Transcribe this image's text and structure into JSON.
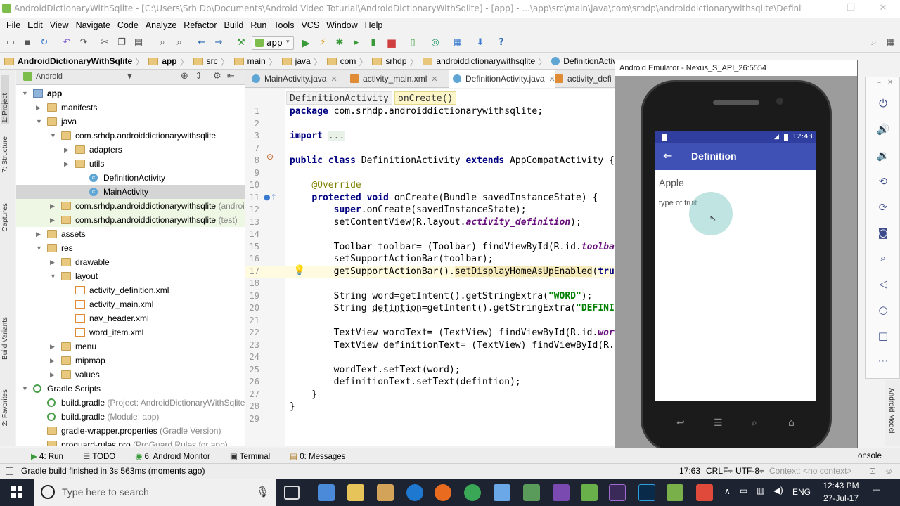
{
  "window": {
    "title": "AndroidDictionaryWithSqlite - [C:\\Users\\Srh Dp\\Documents\\Android Video Toturial\\AndroidDictionaryWithSqlite] - [app] - ...\\app\\src\\main\\java\\com\\srhdp\\androiddictionarywithsqlite\\DefinitionActivity.java - A..."
  },
  "menu": [
    "File",
    "Edit",
    "View",
    "Navigate",
    "Code",
    "Analyze",
    "Refactor",
    "Build",
    "Run",
    "Tools",
    "VCS",
    "Window",
    "Help"
  ],
  "toolbar": {
    "run_config": "app"
  },
  "breadcrumbs": [
    "AndroidDictionaryWithSqlite",
    "app",
    "src",
    "main",
    "java",
    "com",
    "srhdp",
    "androiddictionarywithsqlite",
    "DefinitionActivity"
  ],
  "left_tabs": [
    "1: Project",
    "7: Structure",
    "Captures",
    "Build Variants",
    "2: Favorites"
  ],
  "project": {
    "view_mode": "Android",
    "tree": [
      {
        "label": "app",
        "level": 0,
        "arrow": "down",
        "icon": "foldb",
        "bold": true
      },
      {
        "label": "manifests",
        "level": 1,
        "arrow": "right",
        "icon": "fold"
      },
      {
        "label": "java",
        "level": 1,
        "arrow": "down",
        "icon": "fold"
      },
      {
        "label": "com.srhdp.androiddictionarywithsqlite",
        "level": 2,
        "arrow": "down",
        "icon": "fold"
      },
      {
        "label": "adapters",
        "level": 3,
        "arrow": "right",
        "icon": "fold"
      },
      {
        "label": "utils",
        "level": 3,
        "arrow": "right",
        "icon": "fold"
      },
      {
        "label": "DefinitionActivity",
        "level": 4,
        "arrow": "",
        "icon": "cls"
      },
      {
        "label": "MainActivity",
        "level": 4,
        "arrow": "",
        "icon": "cls",
        "selected": true
      },
      {
        "label": "com.srhdp.androiddictionarywithsqlite",
        "suffix": " (androi",
        "level": 2,
        "arrow": "right",
        "icon": "fold",
        "tinted": true
      },
      {
        "label": "com.srhdp.androiddictionarywithsqlite",
        "suffix": " (test)",
        "level": 2,
        "arrow": "right",
        "icon": "fold",
        "tinted": true
      },
      {
        "label": "assets",
        "level": 1,
        "arrow": "right",
        "icon": "fold"
      },
      {
        "label": "res",
        "level": 1,
        "arrow": "down",
        "icon": "fold"
      },
      {
        "label": "drawable",
        "level": 2,
        "arrow": "right",
        "icon": "fold"
      },
      {
        "label": "layout",
        "level": 2,
        "arrow": "down",
        "icon": "fold"
      },
      {
        "label": "activity_definition.xml",
        "level": 3,
        "arrow": "",
        "icon": "xml"
      },
      {
        "label": "activity_main.xml",
        "level": 3,
        "arrow": "",
        "icon": "xml"
      },
      {
        "label": "nav_header.xml",
        "level": 3,
        "arrow": "",
        "icon": "xml"
      },
      {
        "label": "word_item.xml",
        "level": 3,
        "arrow": "",
        "icon": "xml"
      },
      {
        "label": "menu",
        "level": 2,
        "arrow": "right",
        "icon": "fold"
      },
      {
        "label": "mipmap",
        "level": 2,
        "arrow": "right",
        "icon": "fold"
      },
      {
        "label": "values",
        "level": 2,
        "arrow": "right",
        "icon": "fold"
      },
      {
        "label": "Gradle Scripts",
        "level": 0,
        "arrow": "down",
        "icon": "grad"
      },
      {
        "label": "build.gradle",
        "suffix": " (Project: AndroidDictionaryWithSqlite",
        "level": 1,
        "arrow": "",
        "icon": "grad"
      },
      {
        "label": "build.gradle",
        "suffix": " (Module: app)",
        "level": 1,
        "arrow": "",
        "icon": "grad"
      },
      {
        "label": "gradle-wrapper.properties",
        "suffix": " (Gradle Version)",
        "level": 1,
        "arrow": "",
        "icon": "fold"
      },
      {
        "label": "proguard-rules.pro",
        "suffix": " (ProGuard Rules for app)",
        "level": 1,
        "arrow": "",
        "icon": "fold"
      }
    ]
  },
  "editor_tabs": [
    {
      "label": "MainActivity.java",
      "color": "#5fa6d4"
    },
    {
      "label": "activity_main.xml",
      "color": "#e08b35"
    },
    {
      "label": "DefinitionActivity.java",
      "color": "#5fa6d4",
      "active": true
    },
    {
      "label": "activity_defi",
      "color": "#e08b35"
    }
  ],
  "method_bar": {
    "class": "DefinitionActivity",
    "method": "onCreate()"
  },
  "code": [
    {
      "n": "1",
      "html": "<span class=\"kw\">package</span> com.srhdp.androiddictionarywithsqlite;"
    },
    {
      "n": "2",
      "html": ""
    },
    {
      "n": "3",
      "html": "<span class=\"kw\">import</span> <span style=\"background:#e8f2e8;color:#666\">...</span>"
    },
    {
      "n": "7",
      "html": ""
    },
    {
      "n": "8",
      "html": "<span class=\"kw\">public class</span> DefinitionActivity <span class=\"kw\">extends</span> AppCompatActivity {"
    },
    {
      "n": "9",
      "html": ""
    },
    {
      "n": "10",
      "html": "    <span class=\"an\">@Override</span>"
    },
    {
      "n": "11",
      "html": "    <span class=\"kw\">protected void</span> onCreate(Bundle savedInstanceState) {"
    },
    {
      "n": "12",
      "html": "        <span class=\"kw\">super</span>.onCreate(savedInstanceState);"
    },
    {
      "n": "13",
      "html": "        setContentView(R.layout.<span class=\"it\">activity_definition</span>);"
    },
    {
      "n": "14",
      "html": ""
    },
    {
      "n": "15",
      "html": "        Toolbar toolbar= (Toolbar) findViewById(R.id.<span class=\"it\">toolbar</span>);"
    },
    {
      "n": "16",
      "html": "        setSupportActionBar(toolbar);"
    },
    {
      "n": "17",
      "html": "        getSupportActionBar().<span style=\"background:#f6ebbc\">setDisplayHomeAsUpEnabled</span>(<span class=\"kw\">true</span>);"
    },
    {
      "n": "18",
      "html": ""
    },
    {
      "n": "19",
      "html": "        String word=getIntent().getStringExtra(<span class=\"st\">\"WORD\"</span>);"
    },
    {
      "n": "20",
      "html": "        String <span style=\"text-decoration:underline dotted #999\">defintion</span>=getIntent().getStringExtra(<span class=\"st\">\"DEFINITION\"</span>);"
    },
    {
      "n": "21",
      "html": ""
    },
    {
      "n": "22",
      "html": "        TextView wordText= (TextView) findViewById(R.id.<span class=\"it\">wordText</span>);"
    },
    {
      "n": "23",
      "html": "        TextView definitionText= (TextView) findViewById(R.id.<span class=\"it\">definitionText</span>);"
    },
    {
      "n": "24",
      "html": ""
    },
    {
      "n": "25",
      "html": "        wordText.setText(word);"
    },
    {
      "n": "26",
      "html": "        definitionText.setText(defintion);"
    },
    {
      "n": "27",
      "html": "    }"
    },
    {
      "n": "28",
      "html": "}"
    },
    {
      "n": "29",
      "html": ""
    }
  ],
  "emulator": {
    "title": "Android Emulator - Nexus_S_API_26:5554",
    "clock": "12:43",
    "app_title": "Definition",
    "word": "Apple",
    "definition": "type of fruit"
  },
  "right_tabs": [
    "Android Model"
  ],
  "bottom_tools": [
    {
      "label": "4: Run",
      "icon": "▶",
      "color": "#3a9a3a"
    },
    {
      "label": "TODO",
      "icon": "☰",
      "color": "#555"
    },
    {
      "label": "6: Android Monitor",
      "icon": "◉",
      "color": "#3a9a3a"
    },
    {
      "label": "Terminal",
      "icon": "▣",
      "color": "#333"
    },
    {
      "label": "0: Messages",
      "icon": "▤",
      "color": "#b07d2a"
    }
  ],
  "console_label": "onsole",
  "status": {
    "message": "Gradle build finished in 3s 563ms (moments ago)",
    "position": "17:63",
    "line_sep": "CRLF÷",
    "encoding": "UTF-8÷",
    "context": "Context: <no context>"
  },
  "taskbar": {
    "search_placeholder": "Type here to search",
    "lang": "ENG",
    "time": "12:43 PM",
    "date": "27-Jul-17"
  }
}
